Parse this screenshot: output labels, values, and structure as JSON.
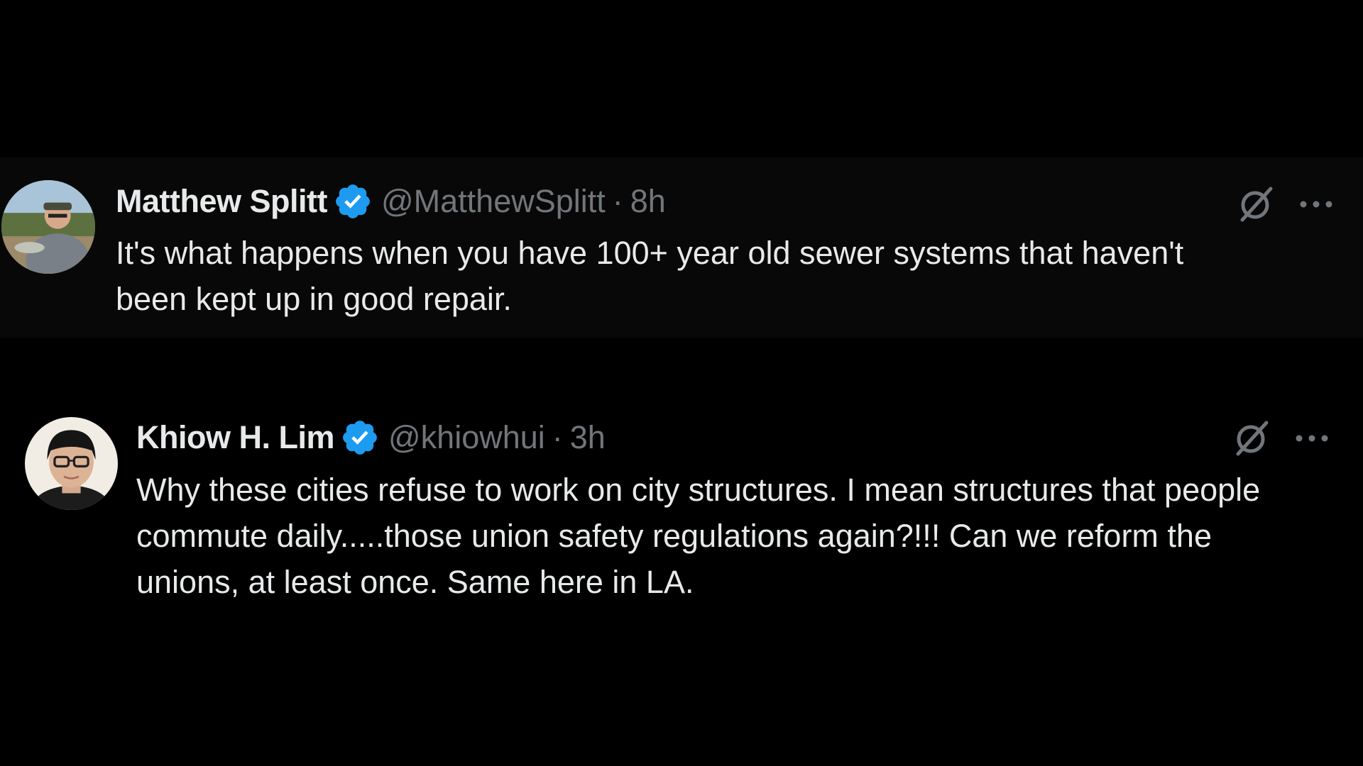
{
  "tweets": [
    {
      "display_name": "Matthew Splitt",
      "handle": "@MatthewSplitt",
      "separator": "·",
      "time": "8h",
      "text": "It's  what happens when you have 100+ year old sewer systems that haven't been kept up in good repair.",
      "verified": true,
      "avatar_icon": "avatar-outdoor-man-with-cap"
    },
    {
      "display_name": "Khiow H. Lim",
      "handle": "@khiowhui",
      "separator": "·",
      "time": "3h",
      "text": "Why these cities refuse to work on city structures. I mean structures that people commute daily.....those union safety regulations again?!!! Can we reform the unions, at least once. Same here in LA.",
      "verified": true,
      "avatar_icon": "avatar-person-with-glasses"
    }
  ],
  "icons": {
    "verified": "verified-badge-icon",
    "grok": "grok-icon",
    "more": "more-options-icon"
  },
  "colors": {
    "background": "#000000",
    "highlight_row": "#080808",
    "text_primary": "#e7e9ea",
    "text_secondary": "#71767b",
    "verified_blue": "#1d9bf0"
  }
}
